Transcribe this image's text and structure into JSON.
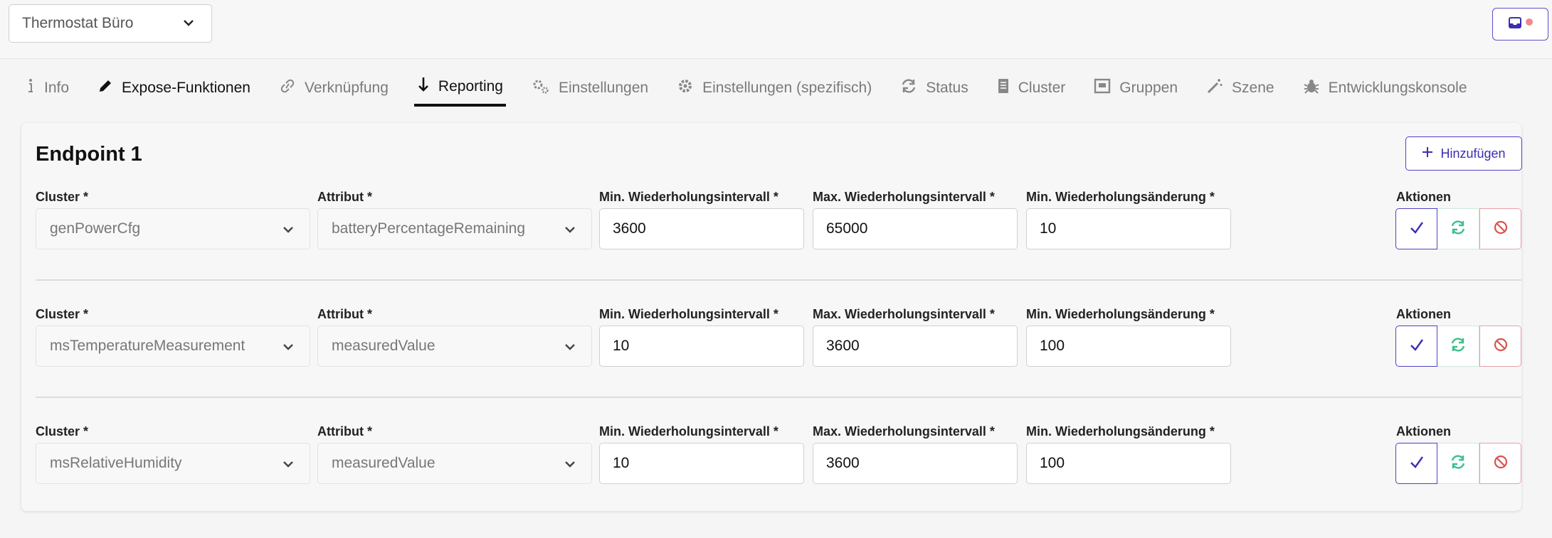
{
  "device_select": {
    "value": "Thermostat Büro",
    "icon": "chevron-down-icon"
  },
  "inbox_button": {
    "icon": "inbox-icon",
    "indicator_color": "#f08a8a"
  },
  "tabs": [
    {
      "label": "Info",
      "icon": "info-icon",
      "active": false
    },
    {
      "label": "Expose-Funktionen",
      "icon": "pencil-icon",
      "active": false
    },
    {
      "label": "Verknüpfung",
      "icon": "link-icon",
      "active": false
    },
    {
      "label": "Reporting",
      "icon": "download-arrow-icon",
      "active": true
    },
    {
      "label": "Einstellungen",
      "icon": "cogs-icon",
      "active": false
    },
    {
      "label": "Einstellungen (spezifisch)",
      "icon": "gear-icon",
      "active": false
    },
    {
      "label": "Status",
      "icon": "sync-icon",
      "active": false
    },
    {
      "label": "Cluster",
      "icon": "document-icon",
      "active": false
    },
    {
      "label": "Gruppen",
      "icon": "group-icon",
      "active": false
    },
    {
      "label": "Szene",
      "icon": "magic-wand-icon",
      "active": false
    },
    {
      "label": "Entwicklungskonsole",
      "icon": "bug-icon",
      "active": false
    }
  ],
  "endpoint": {
    "title": "Endpoint 1",
    "add_label": "Hinzufügen",
    "labels": {
      "cluster": "Cluster *",
      "attribute": "Attribut *",
      "min_interval": "Min. Wiederholungsintervall *",
      "max_interval": "Max. Wiederholungsintervall *",
      "min_change": "Min. Wiederholungsänderung *",
      "actions": "Aktionen"
    },
    "rows": [
      {
        "cluster": "genPowerCfg",
        "attribute": "batteryPercentageRemaining",
        "min_interval": "3600",
        "max_interval": "65000",
        "min_change": "10"
      },
      {
        "cluster": "msTemperatureMeasurement",
        "attribute": "measuredValue",
        "min_interval": "10",
        "max_interval": "3600",
        "min_change": "100"
      },
      {
        "cluster": "msRelativeHumidity",
        "attribute": "measuredValue",
        "min_interval": "10",
        "max_interval": "3600",
        "min_change": "100"
      }
    ]
  },
  "colors": {
    "accent": "#4d40c8",
    "success": "#3cc08c",
    "danger": "#d9534f"
  }
}
